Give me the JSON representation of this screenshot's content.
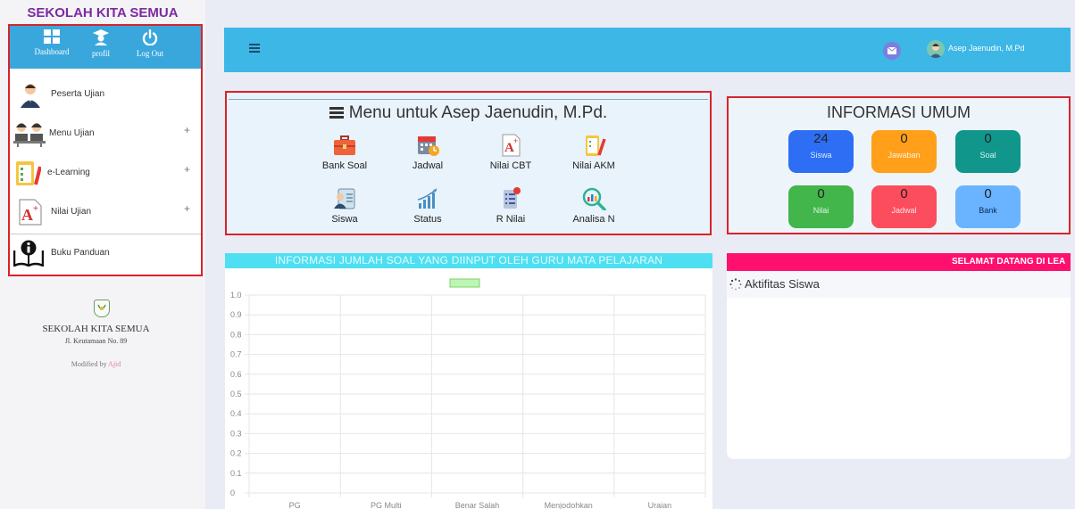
{
  "sidebar": {
    "brand": "SEKOLAH KITA SEMUA",
    "top_buttons": {
      "dashboard": "Dashboard",
      "profil": "profil",
      "logout": "Log Out"
    },
    "items": [
      {
        "label": "Peserta Ujian",
        "expandable": false
      },
      {
        "label": "Menu Ujian",
        "expandable": true
      },
      {
        "label": "e-Learning",
        "expandable": true
      },
      {
        "label": "Nilai Ujian",
        "expandable": true
      },
      {
        "label": "Buku Panduan",
        "expandable": false
      }
    ],
    "plus_glyph": "+",
    "school_name": "SEKOLAH KITA SEMUA",
    "school_address": "Jl. Keutamaan No. 89",
    "modified_prefix": "Modified by",
    "modified_author": "Ajid"
  },
  "topbar": {
    "user_name": "Asep Jaenudin, M.Pd"
  },
  "menu": {
    "title": "Menu untuk Asep Jaenudin, M.Pd.",
    "items": [
      {
        "label": "Bank Soal",
        "icon": "briefcase-icon"
      },
      {
        "label": "Jadwal",
        "icon": "calendar-clock-icon"
      },
      {
        "label": "Nilai CBT",
        "icon": "grade-a-plus-icon"
      },
      {
        "label": "Nilai AKM",
        "icon": "clipboard-pencil-icon"
      },
      {
        "label": "Siswa",
        "icon": "student-id-icon"
      },
      {
        "label": "Status",
        "icon": "bar-growth-icon"
      },
      {
        "label": "R Nilai",
        "icon": "checklist-icon"
      },
      {
        "label": "Analisa N",
        "icon": "magnifier-chart-icon"
      }
    ]
  },
  "info": {
    "title": "INFORMASI UMUM",
    "tiles": [
      {
        "value": "24",
        "label": "Siswa",
        "color": "#2e6ef5",
        "label_color": "#dfe8ff"
      },
      {
        "value": "0",
        "label": "Jawaban",
        "color": "#ff9f1a",
        "label_color": "#fff3dd"
      },
      {
        "value": "0",
        "label": "Soal",
        "color": "#11968c",
        "label_color": "#d9f4f1"
      },
      {
        "value": "0",
        "label": "Nilai",
        "color": "#42b54b",
        "label_color": "#e4f7e5"
      },
      {
        "value": "0",
        "label": "Jadwal",
        "color": "#fb4d5e",
        "label_color": "#ffe3e6"
      },
      {
        "value": "0",
        "label": "Bank",
        "color": "#6ab3ff",
        "label_color": "#0c2a55"
      }
    ]
  },
  "chart_data": {
    "type": "bar",
    "title": "INFORMASI JUMLAH SOAL YANG DIINPUT OLEH GURU MATA PELAJARAN",
    "categories": [
      "PG",
      "PG Multi",
      "Benar Salah",
      "Menjodohkan",
      "Uraian"
    ],
    "series": [
      {
        "values": [
          0,
          0,
          0,
          0,
          0
        ],
        "color": "#bdf5b4"
      }
    ],
    "y_ticks": [
      "0",
      "0.1",
      "0.2",
      "0.3",
      "0.4",
      "0.5",
      "0.6",
      "0.7",
      "0.8",
      "0.9",
      "1.0"
    ],
    "ylim": [
      0,
      1
    ],
    "grid": true,
    "legend": "top-center"
  },
  "activity": {
    "banner": "SELAMAT DATANG DI LEA",
    "title": "Aktifitas Siswa"
  },
  "colors": {
    "topbar": "#3cb7e6",
    "sidebar_header": "#3aa7dc",
    "highlight_border": "#d8232a",
    "banner": "#ff106e",
    "chart_title_bg": "#4ee0f2"
  }
}
